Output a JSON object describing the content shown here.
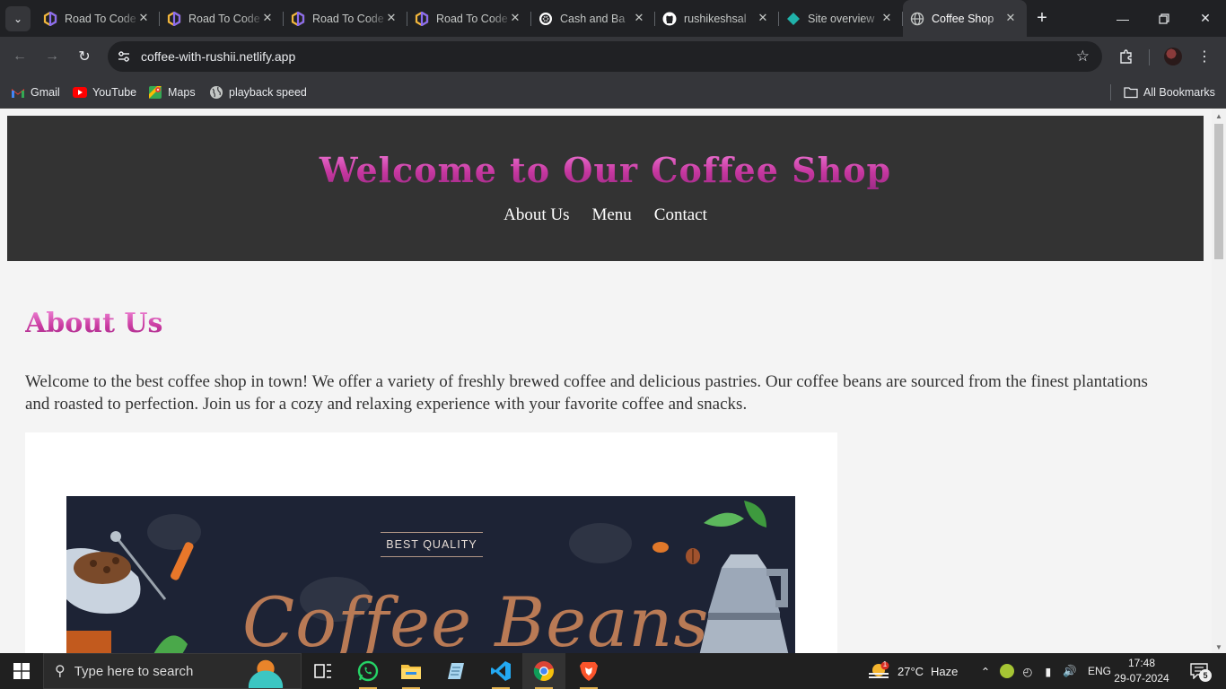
{
  "browser": {
    "tabs": [
      {
        "title": "Road To Code",
        "icon": "hexagon-app-icon",
        "active": false
      },
      {
        "title": "Road To Code",
        "icon": "hexagon-app-icon",
        "active": false
      },
      {
        "title": "Road To Code",
        "icon": "hexagon-app-icon",
        "active": false
      },
      {
        "title": "Road To Code",
        "icon": "hexagon-app-icon",
        "active": false
      },
      {
        "title": "Cash and Ba",
        "icon": "chatgpt-icon",
        "active": false
      },
      {
        "title": "rushikeshsal",
        "icon": "github-icon",
        "active": false
      },
      {
        "title": "Site overview",
        "icon": "netlify-icon",
        "active": false
      },
      {
        "title": "Coffee Shop",
        "icon": "globe-icon",
        "active": true
      }
    ],
    "url": "coffee-with-rushii.netlify.app",
    "bookmarks": [
      {
        "label": "Gmail",
        "icon": "gmail-icon"
      },
      {
        "label": "YouTube",
        "icon": "youtube-icon"
      },
      {
        "label": "Maps",
        "icon": "maps-icon"
      },
      {
        "label": "playback speed",
        "icon": "globe-icon"
      }
    ],
    "all_bookmarks_label": "All Bookmarks"
  },
  "page": {
    "site_title": "Welcome to Our Coffee Shop",
    "nav": [
      "About Us",
      "Menu",
      "Contact"
    ],
    "about_heading": "About Us",
    "about_text": "Welcome to the best coffee shop in town! We offer a variety of freshly brewed coffee and delicious pastries. Our coffee beans are sourced from the finest plantations and roasted to perfection. Join us for a cozy and relaxing experience with your favorite coffee and snacks.",
    "banner": {
      "tag": "BEST QUALITY",
      "headline": "Coffee Beans"
    },
    "colors": {
      "header_bg": "#333333",
      "title_pink": "#d84ab8",
      "page_bg": "#f4f4f4",
      "banner_bg": "#1d2335",
      "banner_text": "#b97a55"
    }
  },
  "taskbar": {
    "search_placeholder": "Type here to search",
    "apps": [
      "task-view-icon",
      "whatsapp-icon",
      "file-explorer-icon",
      "notepad-icon",
      "vscode-icon",
      "chrome-icon",
      "brave-icon"
    ],
    "weather": {
      "temp": "27°C",
      "condition": "Haze",
      "badge": "1"
    },
    "language": "ENG",
    "time": "17:48",
    "date": "29-07-2024",
    "notifications": "5"
  }
}
